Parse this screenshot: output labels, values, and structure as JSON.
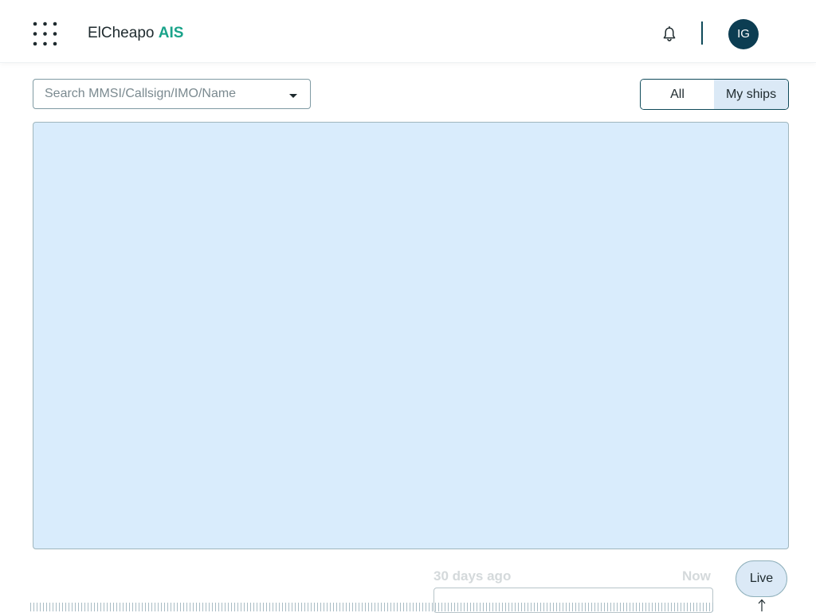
{
  "header": {
    "menu_icon": "grid-dots-icon",
    "brand_name": "ElCheapo",
    "brand_accent": "AIS",
    "notification_icon": "bell-icon",
    "avatar_initials": "IG"
  },
  "search": {
    "placeholder": "Search MMSI/Callsign/IMO/Name",
    "value": "",
    "dropdown_icon": "caret-down-icon"
  },
  "filter_toggle": {
    "options": [
      "All",
      "My ships"
    ],
    "selected": "My ships"
  },
  "timeline": {
    "start_label": "30 days ago",
    "end_label": "Now",
    "live_label": "Live",
    "live_icon": "arrow-up-icon"
  },
  "colors": {
    "brand_accent": "#1aa38a",
    "avatar_bg": "#0c3d52",
    "map_water": "#d9ecfc",
    "selected_toggle": "#dbe9f6"
  }
}
